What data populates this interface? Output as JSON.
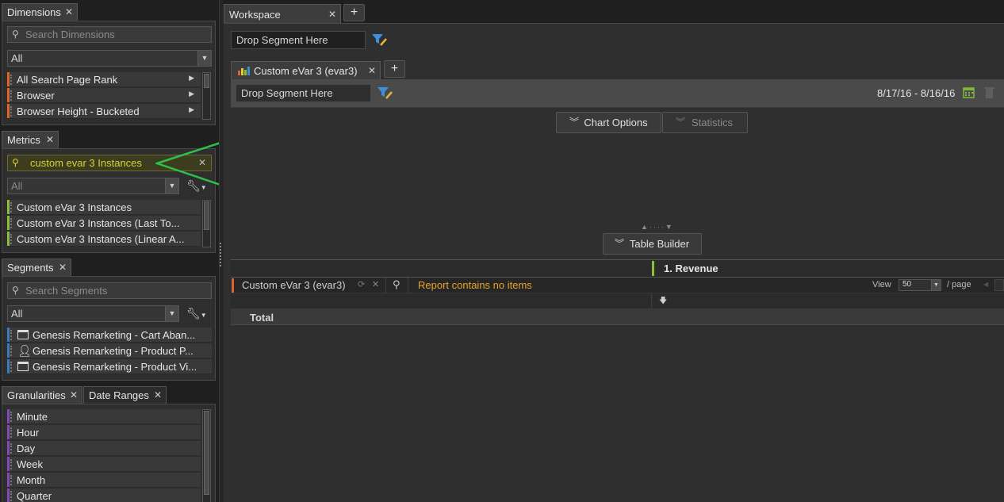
{
  "dimensions": {
    "tab_label": "Dimensions",
    "search_placeholder": "Search Dimensions",
    "filter_value": "All",
    "items": [
      "All Search Page Rank",
      "Browser",
      "Browser Height - Bucketed"
    ]
  },
  "metrics": {
    "tab_label": "Metrics",
    "search_value": "custom evar 3 Instances",
    "filter_value": "All",
    "items": [
      "Custom eVar 3 Instances",
      "Custom eVar 3 Instances (Last To...",
      "Custom eVar 3 Instances (Linear A..."
    ]
  },
  "segments": {
    "tab_label": "Segments",
    "search_placeholder": "Search Segments",
    "filter_value": "All",
    "items": [
      "Genesis Remarketing - Cart Aban...",
      "Genesis Remarketing - Product P...",
      "Genesis Remarketing - Product Vi..."
    ]
  },
  "granularities": {
    "tab_label": "Granularities",
    "tab2_label": "Date Ranges",
    "items": [
      "Minute",
      "Hour",
      "Day",
      "Week",
      "Month",
      "Quarter"
    ]
  },
  "workspace": {
    "tab_label": "Workspace",
    "drop_segment": "Drop Segment Here",
    "report_tab_label": "Custom eVar 3 (evar3)",
    "report_drop_segment": "Drop Segment Here",
    "date_range": "8/17/16 - 8/16/16",
    "chart_options_label": "Chart Options",
    "statistics_label": "Statistics",
    "table_builder_label": "Table Builder",
    "column_header": "1. Revenue",
    "row_dimension": "Custom eVar 3 (evar3)",
    "no_items_message": "Report contains no items",
    "view_label": "View",
    "view_value": "50",
    "per_page_label": "/ page",
    "total_label": "Total"
  },
  "colors": {
    "accent_yellow": "#d9d23a",
    "callout_arrow": "#2fbf4a",
    "message_orange": "#e8a52a"
  }
}
